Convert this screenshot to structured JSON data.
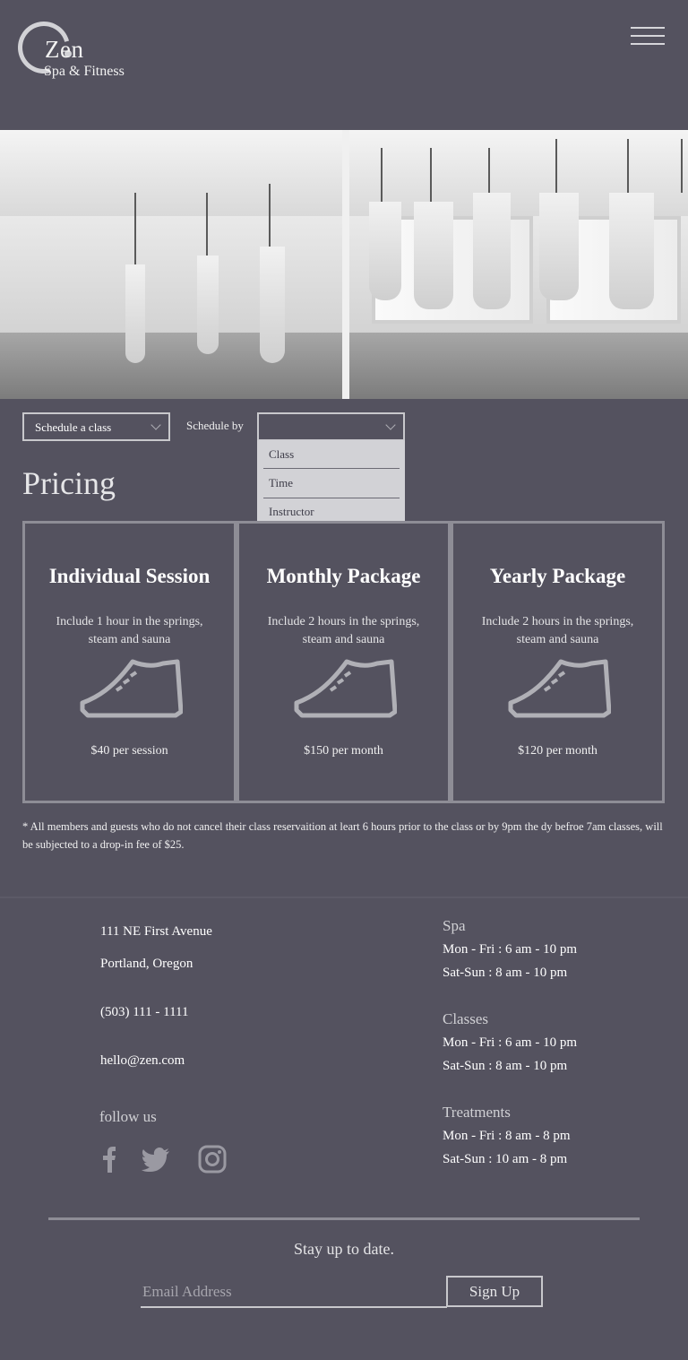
{
  "header": {
    "logo_name": "Zen",
    "logo_subtitle": "Spa & Fitness",
    "menu_icon": "hamburger-icon"
  },
  "schedule": {
    "class_select_value": "Schedule a class",
    "schedule_by_label": "Schedule by",
    "schedule_by_value": "",
    "options": [
      "Class",
      "Time",
      "Instructor"
    ]
  },
  "pricing": {
    "title": "Pricing",
    "cards": [
      {
        "title": "Individual Session",
        "desc": "Include 1 hour in the springs, steam and sauna",
        "price": "$40 per session",
        "icon": "sneaker-icon"
      },
      {
        "title": "Monthly Package",
        "desc": "Include 2 hours in the springs, steam and sauna",
        "price": "$150 per month",
        "icon": "sneaker-icon"
      },
      {
        "title": "Yearly Package",
        "desc": "Include 2 hours in the springs, steam and sauna",
        "price": "$120 per month",
        "icon": "sneaker-icon"
      }
    ],
    "disclaimer": "* All members and guests who do not cancel their class reservaition at leart 6 hours prior to the class or by 9pm the dy befroe 7am classes, will be subjected to a drop-in fee of $25."
  },
  "contact": {
    "address_line1": "111 NE First Avenue",
    "address_line2": "Portland, Oregon",
    "phone": "(503) 111 - 1111",
    "email": "hello@zen.com",
    "follow_label": "follow us",
    "social_icons": [
      "facebook-icon",
      "twitter-icon",
      "instagram-icon"
    ]
  },
  "hours": [
    {
      "heading": "Spa",
      "lines": [
        "Mon - Fri :  6 am - 10 pm",
        "Sat-Sun : 8 am - 10 pm"
      ]
    },
    {
      "heading": "Classes",
      "lines": [
        "Mon - Fri :  6 am - 10 pm",
        "Sat-Sun :  8 am - 10 pm"
      ]
    },
    {
      "heading": "Treatments",
      "lines": [
        "Mon - Fri :  8 am - 8 pm",
        "Sat-Sun :  10 am - 8 pm"
      ]
    }
  ],
  "newsletter": {
    "title": "Stay up to date.",
    "email_placeholder": "Email Address",
    "signup_label": "Sign Up"
  },
  "colors": {
    "background": "#54525f",
    "border": "#8e8d96",
    "dropdown_bg": "#d2d2d6"
  }
}
